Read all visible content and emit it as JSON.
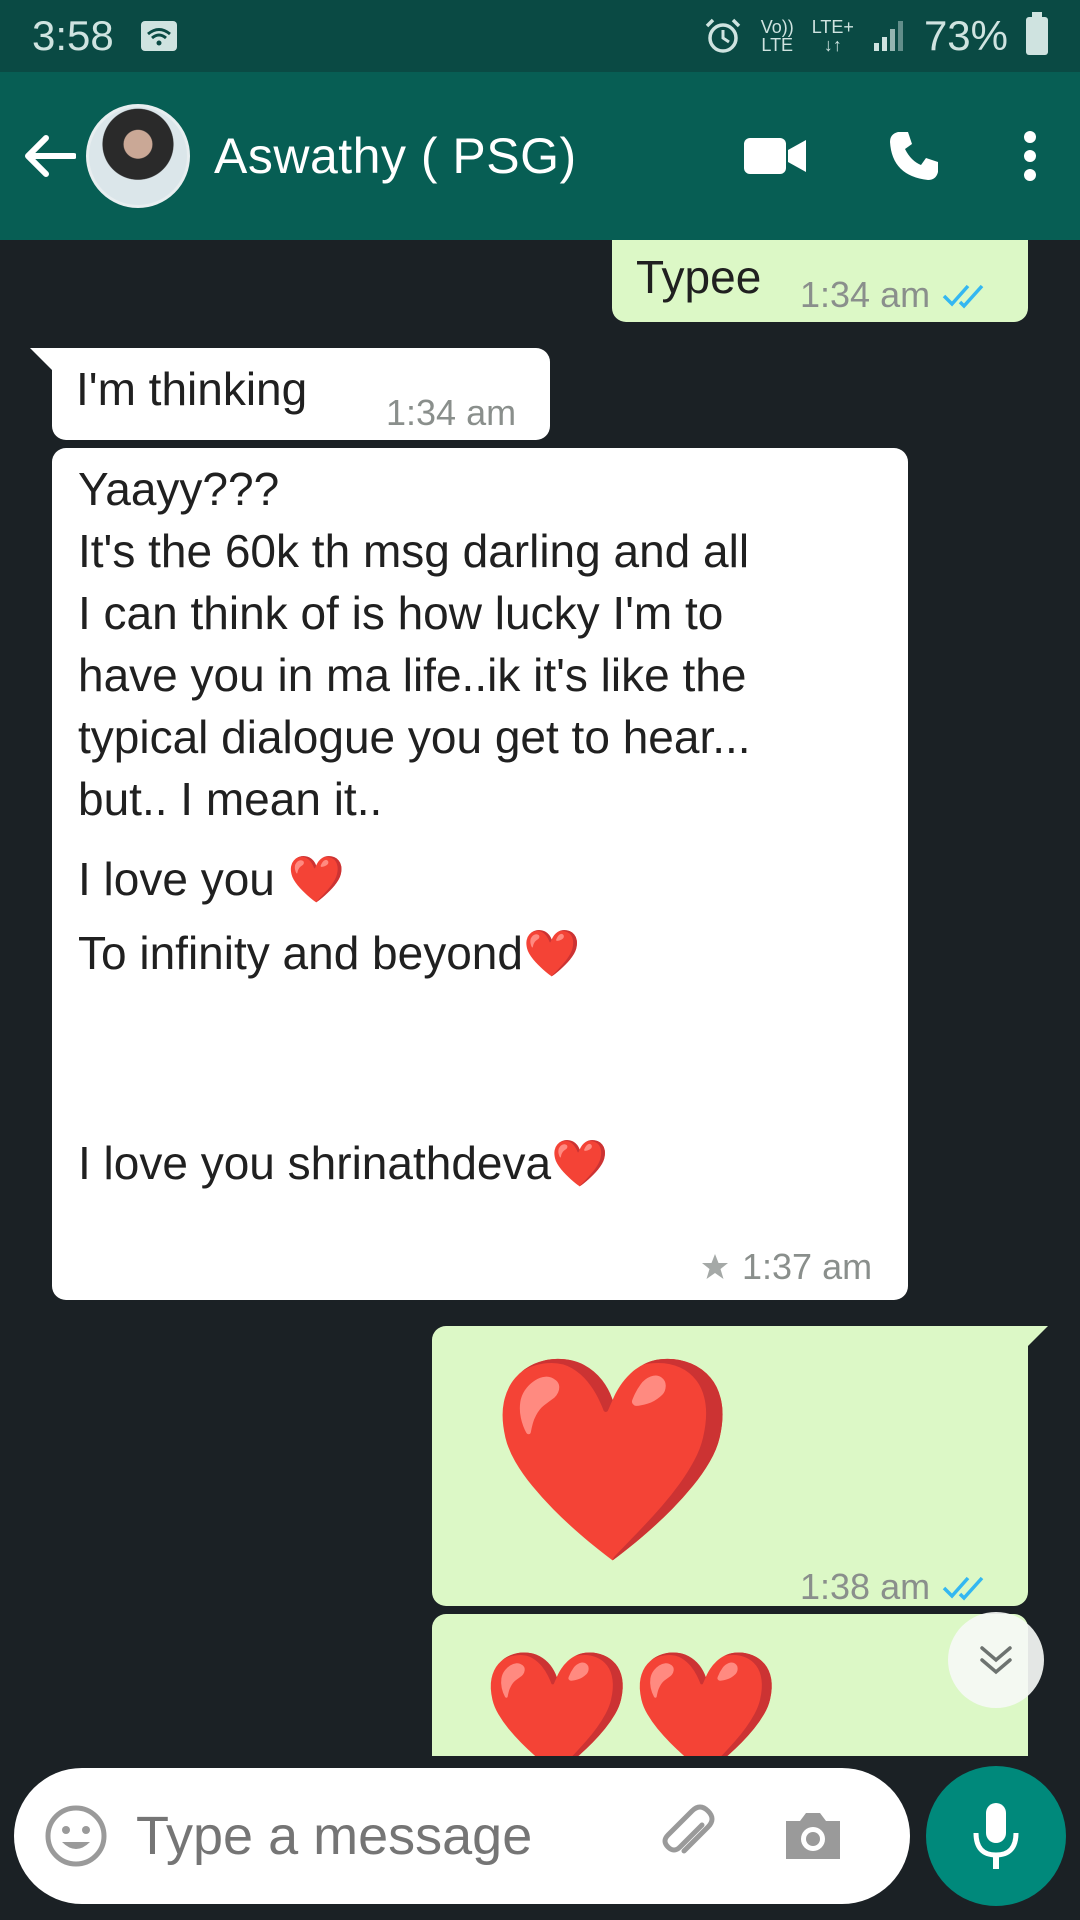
{
  "status": {
    "time": "3:58",
    "volte_top": "Vo))",
    "volte_bottom": "LTE",
    "lte": "LTE+",
    "battery": "73%"
  },
  "header": {
    "contact_name": "Aswathy ( PSG)"
  },
  "messages": {
    "m1": {
      "text": "Typee",
      "time": "1:34 am"
    },
    "m2": {
      "text": "I'm thinking",
      "time": "1:34 am"
    },
    "m3": {
      "line1": "Yaayy???",
      "line2": "It's the 60k th msg darling and all",
      "line3": "I can think of is how lucky I'm to",
      "line4": "have you in ma life..ik it's like the",
      "line5": "typical dialogue you get to hear...",
      "line6": "but.. I mean it..",
      "line7": "I love you ❤️",
      "line8": "To infinity and beyond❤️",
      "line9": "I love you shrinathdeva❤️",
      "time": "1:37 am"
    },
    "m4": {
      "emoji": "❤️",
      "time": "1:38 am"
    },
    "m5": {
      "emoji": "❤️❤️"
    }
  },
  "input": {
    "placeholder": "Type a message"
  },
  "colors": {
    "header": "#075e54",
    "status_bar": "#0a4a44",
    "outgoing_bubble": "#dcf8c6",
    "incoming_bubble": "#ffffff",
    "chat_bg": "#1b2125",
    "read_ticks": "#34b7f1",
    "mic_button": "#00897b"
  }
}
